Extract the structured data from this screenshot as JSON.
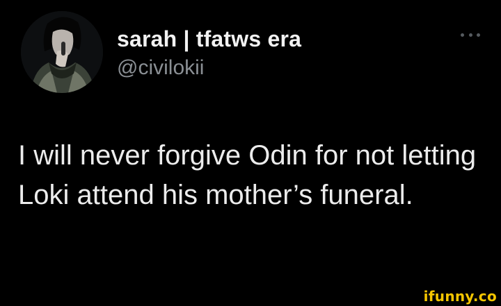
{
  "tweet": {
    "display_name": "sarah | tfatws era",
    "handle": "@civilokii",
    "more_icon": "more-horizontal-icon",
    "text": "I will never forgive Odin for not letting Loki attend his mother’s funeral."
  },
  "watermark": {
    "text": "ifunny.co",
    "color": "#f5c600"
  },
  "colors": {
    "background": "#000000",
    "name": "#f2f2f2",
    "handle": "#8a8f94",
    "body": "#ececec"
  }
}
